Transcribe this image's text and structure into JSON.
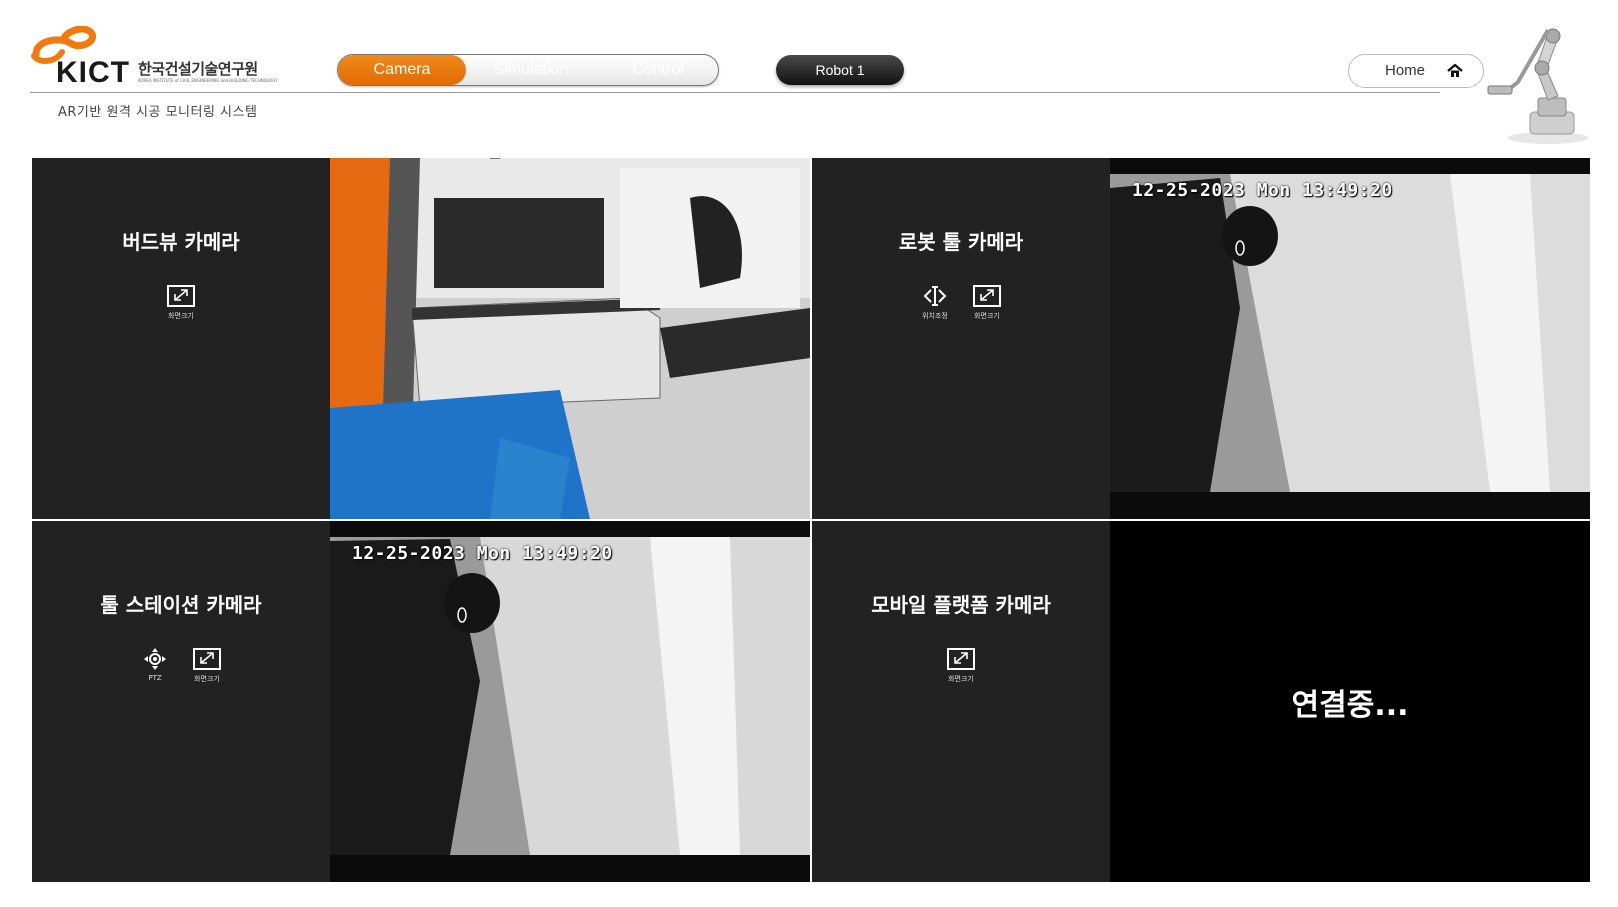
{
  "header": {
    "logo_text": "KICT",
    "logo_korean": "한국건설기술연구원",
    "logo_english": "KOREA INSTITUTE of CIVIL ENGINEERING and BUILDING TECHNOLOGY",
    "subtitle": "AR기반 원격 시공 모니터링 시스템",
    "tabs": [
      {
        "label": "Camera",
        "active": true
      },
      {
        "label": "Simulation",
        "active": false
      },
      {
        "label": "Control",
        "active": false
      }
    ],
    "robot_button": "Robot 1",
    "home_button": "Home"
  },
  "panels": [
    {
      "title": "버드뷰 카메라",
      "controls": [
        {
          "icon": "resize-icon",
          "label": "화면크기"
        }
      ]
    },
    {
      "title": "로봇 툴 카메라",
      "controls": [
        {
          "icon": "position-adjust-icon",
          "label": "위치조정"
        },
        {
          "icon": "resize-icon",
          "label": "화면크기"
        }
      ],
      "osd": "12-25-2023 Mon 13:49:20"
    },
    {
      "title": "툴 스테이션 카메라",
      "controls": [
        {
          "icon": "ptz-icon",
          "label": "PTZ"
        },
        {
          "icon": "resize-icon",
          "label": "화면크기"
        }
      ],
      "osd": "12-25-2023 Mon 13:49:20"
    },
    {
      "title": "모바일 플랫폼 카메라",
      "controls": [
        {
          "icon": "resize-icon",
          "label": "화면크기"
        }
      ],
      "status": "연결중..."
    }
  ],
  "colors": {
    "accent_orange": "#e8750a",
    "panel_bg": "#222222",
    "logo_orange": "#f07a10"
  }
}
